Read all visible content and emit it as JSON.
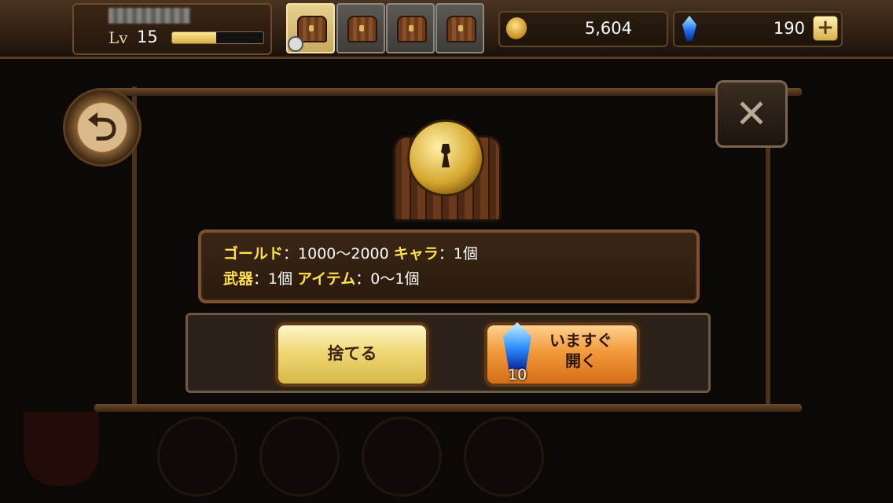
{
  "player": {
    "level_label": "Lv",
    "level": "15",
    "xp_fraction": 0.48
  },
  "chest_slots": [
    {
      "icon": "treasure-chest-icon",
      "active": true,
      "has_timer": true
    },
    {
      "icon": "treasure-chest-icon",
      "active": false
    },
    {
      "icon": "treasure-chest-icon",
      "active": false
    },
    {
      "icon": "treasure-chest-icon",
      "active": false
    }
  ],
  "currency": {
    "gold": "5,604",
    "gems": "190",
    "add_label": "+"
  },
  "dialog": {
    "info": {
      "gold_label": "ゴールド",
      "gold_value": "：1000〜2000",
      "chara_label": "キャラ",
      "chara_value": "：1個",
      "weapon_label": "武器",
      "weapon_value": "：1個",
      "item_label": "アイテム",
      "item_value": "：0〜1個"
    },
    "discard_label": "捨てる",
    "open_now_label_line1": "いますぐ",
    "open_now_label_line2": "開く",
    "open_cost": "10"
  },
  "colors": {
    "highlight": "#ffe24a",
    "wood": "#4a3018",
    "accent_orange": "#f39a3a"
  }
}
